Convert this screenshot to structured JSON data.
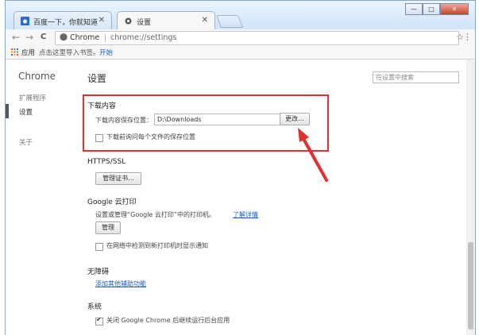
{
  "tabs": [
    {
      "title": "百度一下，你就知道",
      "active": false
    },
    {
      "title": "设置",
      "active": true
    }
  ],
  "window_controls": {
    "minimize": "—",
    "maximize": "□",
    "close": "✕"
  },
  "toolbar": {
    "back": "←",
    "forward": "→",
    "reload": "C",
    "omni_label": "Chrome",
    "url": "chrome://settings",
    "star": "☆",
    "menu": "⋮"
  },
  "bookmarks": {
    "apps": "应用",
    "hint": "点击这里导入书签。",
    "start": "开始"
  },
  "sidebar": {
    "brand": "Chrome",
    "items": [
      "扩展程序",
      "设置",
      "关于"
    ]
  },
  "page": {
    "title": "设置",
    "search_placeholder": "在设置中搜索",
    "downloads": {
      "title": "下载内容",
      "location_label": "下载内容保存位置：",
      "location_value": "D:\\Downloads",
      "change_button": "更改...",
      "ask_label": "下载前询问每个文件的保存位置"
    },
    "https": {
      "title": "HTTPS/SSL",
      "manage_certs": "管理证书..."
    },
    "cloud_print": {
      "title": "Google 云打印",
      "description": "设置或管理“Google 云打印”中的打印机。",
      "learn_more": "了解详情",
      "manage": "管理",
      "notify_label": "在网络中检测到新打印机时显示通知"
    },
    "accessibility": {
      "title": "无障碍",
      "add_features": "添加其他辅助功能"
    },
    "system": {
      "title": "系统",
      "background_label": "关闭 Google Chrome 后继续运行后台应用"
    }
  },
  "colors": {
    "annotation": "#e03030",
    "link": "#1a5ccc"
  }
}
